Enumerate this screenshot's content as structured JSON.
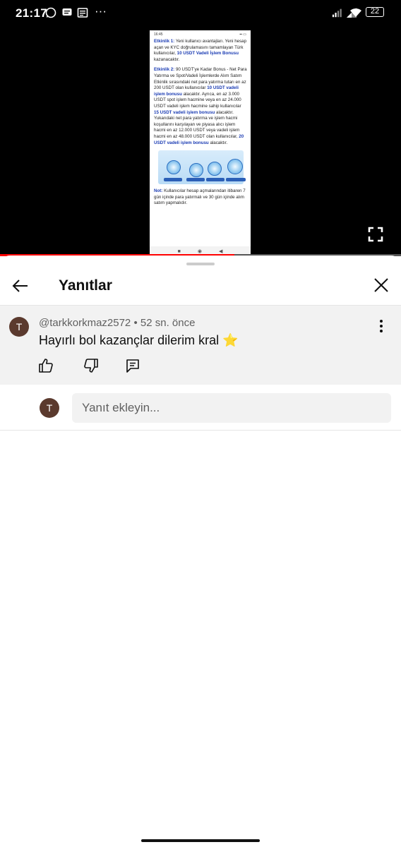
{
  "status_bar": {
    "time": "21:17",
    "battery": "22"
  },
  "video": {
    "thumb_time": "16:45",
    "paragraphs": [
      {
        "parts": [
          {
            "t": "Etkinlik 1:",
            "b": true
          },
          {
            "t": " Yeni kullanıcı avantajları. Yeni hesap açan ve KYC doğrulamasını tamamlayan Türk kullanıcılar, ",
            "b": false
          },
          {
            "t": "10 USDT Vadeli İşlem Bonusu",
            "b": true
          },
          {
            "t": " kazanacaktır.",
            "b": false
          }
        ]
      },
      {
        "parts": [
          {
            "t": "Etkinlik 2:",
            "b": true
          },
          {
            "t": " 90 USDT'ye Kadar Bonus - Net Para Yatırma ve Spot/Vadeli İşlemlerde Alım Satım Etkinlik sırasındaki net para yatırma tutarı en az 200 USDT olan kullanıcılar ",
            "b": false
          },
          {
            "t": "10 USDT vadeli işlem bonusu",
            "b": true
          },
          {
            "t": " alacaktır. Ayrıca, en az 3.000 USDT spot işlem hacmine veya en az 24.000 USDT vadeli işlem hacmine sahip kullanıcılar ",
            "b": false
          },
          {
            "t": "15 USDT vadeli işlem bonusu",
            "b": true
          },
          {
            "t": " alacaktır. Yukarıdaki net para yatırma ve işlem hacmi koşullarını karşılayan ve piyasa alıcı işlem hacmi en az 12.000 USDT veya vadeli işlem hacmi en az 48.000 USDT olan kullanıcılar, ",
            "b": false
          },
          {
            "t": "20 USDT vadeli işlem bonusu",
            "b": true
          },
          {
            "t": " alacaktır.",
            "b": false
          }
        ]
      },
      {
        "parts": [
          {
            "t": "Not:",
            "b": true
          },
          {
            "t": " Kullanıcılar hesap açmalarından itibaren 7 gün içinde para yatırmalı ve 30 gün içinde alım satım yapmalıdır.",
            "b": false
          }
        ]
      }
    ],
    "progress_fraction": 0.585
  },
  "sheet": {
    "title": "Yanıtlar",
    "back_icon": "arrow-left-icon",
    "close_icon": "close-icon"
  },
  "comment": {
    "avatar_letter": "T",
    "username": "@tarkkorkmaz2572",
    "separator": " • ",
    "time_ago": "52 sn. önce",
    "text": "Hayırlı bol kazançlar dilerim kral",
    "emoji": "⭐",
    "actions": [
      "like-icon",
      "dislike-icon",
      "reply-icon"
    ]
  },
  "reply": {
    "avatar_letter": "T",
    "placeholder": "Yanıt ekleyin..."
  },
  "colors": {
    "accent_red": "#ff0000",
    "avatar_bg": "#5b3a2e",
    "link_blue": "#1a3bb3"
  }
}
